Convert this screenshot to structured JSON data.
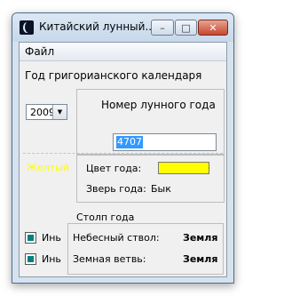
{
  "window": {
    "title": "Китайский лунный...",
    "controls": {
      "minimize": "–",
      "maximize": "□",
      "close": "✕"
    }
  },
  "menu": {
    "items": [
      "Файл"
    ]
  },
  "gregorian": {
    "label": "Год григорианского календаря",
    "year": "2009"
  },
  "lunar": {
    "label": "Номер лунного года",
    "value": "4707"
  },
  "element": {
    "name": "Желтый",
    "color": "#ffff00"
  },
  "properties": {
    "color_label": "Цвет года:",
    "animal_label": "Зверь года:",
    "animal_value": "Бык"
  },
  "pillar": {
    "title": "Столп года",
    "heavenly_label": "Небесный ствол:",
    "heavenly_value": "Земля",
    "earthly_label": "Земная ветвь:",
    "earthly_value": "Земля"
  },
  "yin_yang": {
    "heavenly": "Инь",
    "earthly": "Инь",
    "indicator_color": "#008080"
  }
}
